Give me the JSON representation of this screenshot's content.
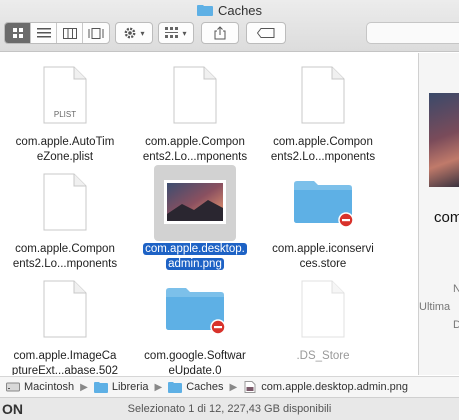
{
  "window": {
    "title": "Caches"
  },
  "toolbar": {
    "view_modes": [
      "icon-view",
      "list-view",
      "column-view",
      "gallery-view"
    ],
    "active_view": "icon-view"
  },
  "files": [
    {
      "name": "com.apple.AutoTimeZone.plist",
      "line1": "com.apple.AutoTim",
      "line2": "eZone.plist",
      "type": "plist",
      "badge": "PLIST"
    },
    {
      "name": "com.apple.Components2.Lo...mponents",
      "line1": "com.apple.Compon",
      "line2": "ents2.Lo...mponents",
      "type": "doc"
    },
    {
      "name": "com.apple.Components2.Lo...mponents",
      "line1": "com.apple.Compon",
      "line2": "ents2.Lo...mponents",
      "type": "doc"
    },
    {
      "name": "com.apple.Components2.Lo...mponents",
      "line1": "com.apple.Compon",
      "line2": "ents2.Lo...mponents",
      "type": "doc"
    },
    {
      "name": "com.apple.desktop.admin.png",
      "line1": "com.apple.desktop.",
      "line2": "admin.png",
      "type": "image",
      "selected": true
    },
    {
      "name": "com.apple.iconservices.store",
      "line1": "com.apple.iconservi",
      "line2": "ces.store",
      "type": "folder-locked"
    },
    {
      "name": "com.apple.ImageCaptureExt...abase.502",
      "line1": "com.apple.ImageCa",
      "line2": "ptureExt...abase.502",
      "type": "doc"
    },
    {
      "name": "com.google.SoftwareUpdate.0",
      "line1": "com.google.Softwar",
      "line2": "eUpdate.0",
      "type": "folder-locked"
    },
    {
      "name": ".DS_Store",
      "line1": ".DS_Store",
      "line2": "",
      "type": "doc",
      "dim": true
    }
  ],
  "preview": {
    "name": "com",
    "lines": [
      "N",
      "Ultima",
      "D"
    ]
  },
  "pathbar": {
    "items": [
      {
        "label": "Macintosh",
        "icon": "disk-icon"
      },
      {
        "label": "Libreria",
        "icon": "folder-icon"
      },
      {
        "label": "Caches",
        "icon": "folder-icon"
      },
      {
        "label": "com.apple.desktop.admin.png",
        "icon": "image-file-icon"
      }
    ]
  },
  "status": {
    "text": "Selezionato 1 di 12, 227,43 GB disponibili",
    "left_edge": "ON"
  },
  "colors": {
    "accent": "#1d62c5",
    "folder": "#5eb0e5",
    "locked_badge": "#d8322b"
  }
}
